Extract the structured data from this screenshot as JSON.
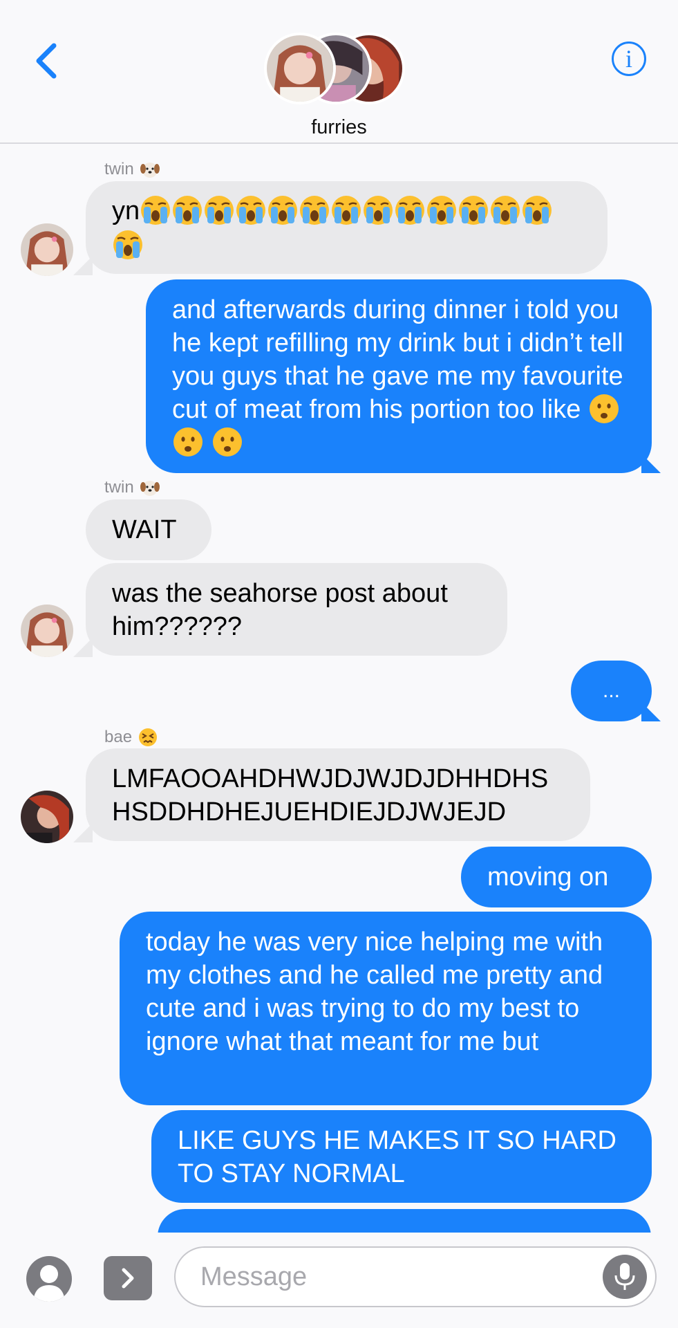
{
  "header": {
    "group_name": "furries",
    "back_icon": "chevron-left-icon",
    "info_icon": "info-icon",
    "info_glyph": "i"
  },
  "messages": {
    "twin_label_1": "twin",
    "m1_text": "yn",
    "m2_text": "and afterwards during dinner i told you he kept refilling my drink but i didn’t tell you guys that he gave me my favourite cut of meat from his portion too like",
    "twin_label_2": "twin",
    "m3_text": "WAIT",
    "m4_text": "was the seahorse post about him??????",
    "m5_text": "...",
    "bae_label": "bae",
    "m6_line1": "LMFAOOAHDHWJDJWJDJDHHDHS",
    "m6_line2": "HSDDHDHEJUEHDIEJDJWJEJD",
    "m7_text": "moving on",
    "m8_text": "today he was very nice helping me with my clothes and he called me pretty and cute and i was trying to do my best to ignore what that meant for me but",
    "m9_line1": "LIKE GUYS HE MAKES IT SO HARD",
    "m9_line2": "TO STAY NORMAL"
  },
  "emojis": {
    "crying": "loudly-crying-face",
    "frowning": "frowning-face-open-mouth",
    "dog": "dog-face",
    "confounded": "confounded-face"
  },
  "input": {
    "placeholder": "Message"
  },
  "colors": {
    "accent": "#1a82fb",
    "incoming": "#e9e9eb",
    "background": "#f9f9fb"
  }
}
